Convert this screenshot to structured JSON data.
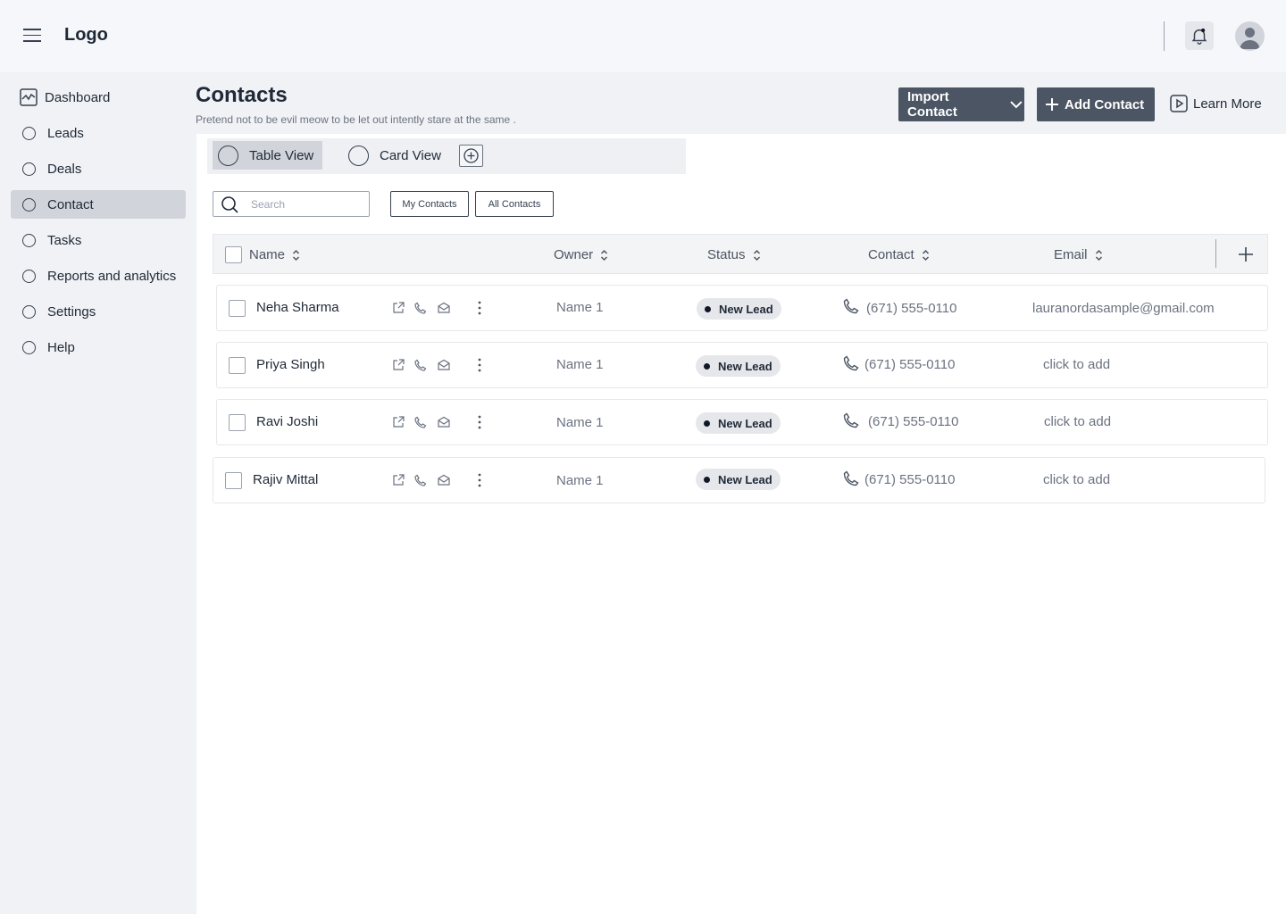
{
  "header": {
    "logo": "Logo"
  },
  "sidebar": {
    "items": [
      {
        "label": "Dashboard",
        "icon": "chart-icon",
        "active": false
      },
      {
        "label": "Leads",
        "icon": "circle-icon",
        "active": false
      },
      {
        "label": "Deals",
        "icon": "circle-icon",
        "active": false
      },
      {
        "label": "Contact",
        "icon": "circle-icon",
        "active": true
      },
      {
        "label": "Tasks",
        "icon": "circle-icon",
        "active": false
      },
      {
        "label": "Reports and analytics",
        "icon": "circle-icon",
        "active": false
      },
      {
        "label": "Settings",
        "icon": "circle-icon",
        "active": false
      },
      {
        "label": "Help",
        "icon": "circle-icon",
        "active": false
      }
    ]
  },
  "page": {
    "title": "Contacts",
    "subtitle": "Pretend not to be evil meow to be let out intently stare at the same .",
    "import_label": "Import Contact",
    "add_label": "Add Contact",
    "learn_label": "Learn More"
  },
  "views": {
    "tabs": [
      {
        "label": "Table View",
        "selected": true
      },
      {
        "label": "Card View",
        "selected": false
      }
    ]
  },
  "search": {
    "placeholder": "Search"
  },
  "filters": {
    "my_contacts": "My Contacts",
    "all_contacts": "All Contacts"
  },
  "table": {
    "columns": {
      "name": "Name",
      "owner": "Owner",
      "status": "Status",
      "contact": "Contact",
      "email": "Email"
    },
    "rows": [
      {
        "name": "Neha Sharma",
        "owner": "Name 1",
        "status": "New Lead",
        "phone": "(671) 555-0110",
        "email": "lauranordasample@gmail.com"
      },
      {
        "name": "Priya Singh",
        "owner": "Name 1",
        "status": "New Lead",
        "phone": "(671) 555-0110",
        "email": "click to add"
      },
      {
        "name": "Ravi Joshi",
        "owner": "Name 1",
        "status": "New Lead",
        "phone": "(671) 555-0110",
        "email": "click to add"
      },
      {
        "name": "Rajiv Mittal",
        "owner": "Name 1",
        "status": "New Lead",
        "phone": "(671) 555-0110",
        "email": "click to add"
      }
    ]
  },
  "colors": {
    "sidebar_bg": "#f0f2f5",
    "active_item": "#d1d5db",
    "primary_button": "#4b5563",
    "badge_bg": "#e5e7eb"
  }
}
